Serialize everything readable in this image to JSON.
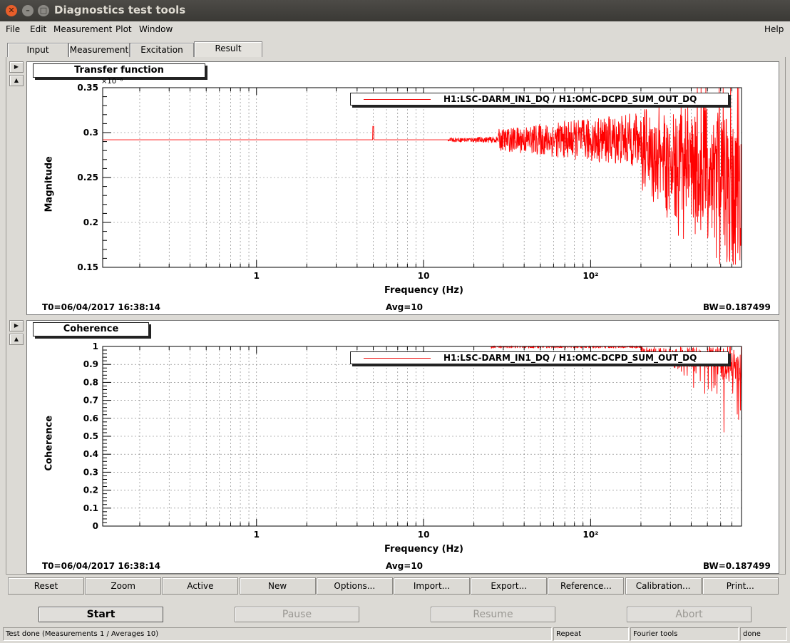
{
  "window": {
    "title": "Diagnostics test tools"
  },
  "menu": {
    "file": "File",
    "edit": "Edit",
    "measurement": "Measurement",
    "plot": "Plot",
    "window": "Window",
    "help": "Help"
  },
  "tabs": [
    "Input",
    "Measurement",
    "Excitation",
    "Result"
  ],
  "plots": [
    {
      "title": "Transfer function",
      "legend": "H1:LSC-DARM_IN1_DQ / H1:OMC-DCPD_SUM_OUT_DQ",
      "ylabel": "Magnitude",
      "xlabel": "Frequency (Hz)",
      "yexponent": "×10⁻⁶",
      "t0": "T0=06/04/2017 16:38:14",
      "avg": "Avg=10",
      "bw": "BW=0.187499"
    },
    {
      "title": "Coherence",
      "legend": "H1:LSC-DARM_IN1_DQ / H1:OMC-DCPD_SUM_OUT_DQ",
      "ylabel": "Coherence",
      "xlabel": "Frequency (Hz)",
      "t0": "T0=06/04/2017 16:38:14",
      "avg": "Avg=10",
      "bw": "BW=0.187499"
    }
  ],
  "chart_data": [
    {
      "type": "line",
      "xscale": "log",
      "xlim": [
        0.12,
        800
      ],
      "ylim": [
        0.15,
        0.35
      ],
      "yticks": [
        "0.15",
        "0.2",
        "0.25",
        "0.3",
        "0.35"
      ],
      "xticks": [
        "1",
        "10",
        "10²"
      ],
      "series_color": "#ff0000",
      "base_value": 0.292,
      "series": [
        {
          "name": "H1:LSC-DARM_IN1_DQ / H1:OMC-DCPD_SUM_OUT_DQ",
          "x": [
            0.12,
            5,
            20,
            30,
            100,
            200,
            500,
            800
          ],
          "y": [
            0.292,
            0.292,
            0.292,
            0.29,
            0.285,
            0.28,
            0.26,
            0.24
          ]
        }
      ],
      "grid": true
    },
    {
      "type": "line",
      "xscale": "log",
      "xlim": [
        0.12,
        800
      ],
      "ylim": [
        0,
        1
      ],
      "yticks": [
        "0",
        "0.1",
        "0.2",
        "0.3",
        "0.4",
        "0.5",
        "0.6",
        "0.7",
        "0.8",
        "0.9",
        "1"
      ],
      "xticks": [
        "1",
        "10",
        "10²"
      ],
      "series_color": "#ff0000",
      "base_value": 1.0,
      "series": [
        {
          "name": "H1:LSC-DARM_IN1_DQ / H1:OMC-DCPD_SUM_OUT_DQ",
          "x": [
            0.12,
            30,
            100,
            200,
            400,
            800
          ],
          "y": [
            1,
            1,
            0.99,
            0.95,
            0.85,
            0.75
          ]
        }
      ],
      "grid": true
    }
  ],
  "buttons": [
    "Reset",
    "Zoom",
    "Active",
    "New",
    "Options...",
    "Import...",
    "Export...",
    "Reference...",
    "Calibration...",
    "Print..."
  ],
  "control": {
    "start": "Start",
    "pause": "Pause",
    "resume": "Resume",
    "abort": "Abort"
  },
  "statusbar": {
    "message": "Test done (Measurements 1 / Averages 10)",
    "repeat": "Repeat",
    "fourier": "Fourier tools",
    "state": "done"
  }
}
